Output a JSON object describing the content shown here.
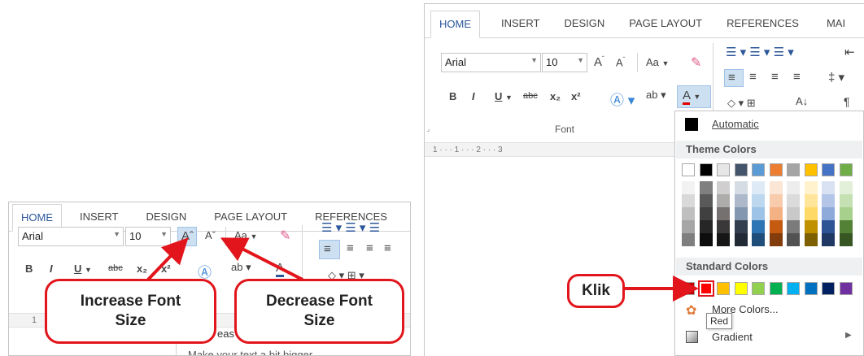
{
  "left_panel": {
    "tabs": [
      "HOME",
      "INSERT",
      "DESIGN",
      "PAGE LAYOUT",
      "REFERENCES"
    ],
    "font_name": "Arial",
    "font_size": "10",
    "increase_font_icon": "Aˆ",
    "decrease_font_icon": "Aˇ",
    "change_case": "Aa",
    "bold": "B",
    "italic": "I",
    "underline": "U",
    "strikethrough": "abc",
    "subscript": "x₂",
    "superscript": "x²",
    "ruler_text": "1",
    "doc_text_1": "eas",
    "doc_text_2": "Make your text a bit bigger"
  },
  "callouts": {
    "increase": "Increase Font Size",
    "decrease": "Decrease Font Size",
    "klik": "Klik"
  },
  "right_panel": {
    "tabs": [
      "HOME",
      "INSERT",
      "DESIGN",
      "PAGE LAYOUT",
      "REFERENCES",
      "MAI"
    ],
    "font_name": "Arial",
    "font_size": "10",
    "change_case": "Aa",
    "bold": "B",
    "italic": "I",
    "underline": "U",
    "strikethrough": "abc",
    "subscript": "x₂",
    "superscript": "x²",
    "group_label": "Font",
    "ruler": "1 · · · 1 · · · 2 · · · 3"
  },
  "palette": {
    "automatic": "Automatic",
    "theme_header": "Theme Colors",
    "standard_header": "Standard Colors",
    "more_colors": "More Colors...",
    "gradient": "Gradient",
    "tooltip": "Red",
    "theme_top": [
      "#ffffff",
      "#000000",
      "#e7e6e6",
      "#44546a",
      "#5b9bd5",
      "#ed7d31",
      "#a5a5a5",
      "#ffc000",
      "#4472c4",
      "#70ad47"
    ],
    "theme_shades": [
      [
        "#f2f2f2",
        "#d9d9d9",
        "#bfbfbf",
        "#a6a6a6",
        "#7f7f7f"
      ],
      [
        "#7f7f7f",
        "#595959",
        "#404040",
        "#262626",
        "#0d0d0d"
      ],
      [
        "#d0cece",
        "#aeabab",
        "#757171",
        "#3a3838",
        "#171616"
      ],
      [
        "#d6dce4",
        "#adb9ca",
        "#8497b0",
        "#333f4f",
        "#222a35"
      ],
      [
        "#deebf6",
        "#bdd7ee",
        "#9dc3e6",
        "#2e75b5",
        "#1e4e79"
      ],
      [
        "#fbe5d5",
        "#f7cbac",
        "#f4b183",
        "#c55a11",
        "#833c0b"
      ],
      [
        "#ededed",
        "#dbdbdb",
        "#c9c9c9",
        "#7b7b7b",
        "#525252"
      ],
      [
        "#fff2cc",
        "#fee599",
        "#ffd965",
        "#bf9000",
        "#7f6000"
      ],
      [
        "#d9e2f3",
        "#b4c6e7",
        "#8eaadb",
        "#2f5496",
        "#1f3864"
      ],
      [
        "#e2efd9",
        "#c5e0b3",
        "#a8d08d",
        "#538135",
        "#375623"
      ]
    ],
    "standard": [
      "#c00000",
      "#ff0000",
      "#ffc000",
      "#ffff00",
      "#92d050",
      "#00b050",
      "#00b0f0",
      "#0070c0",
      "#002060",
      "#7030a0"
    ],
    "accent_red": "#e1151b"
  }
}
